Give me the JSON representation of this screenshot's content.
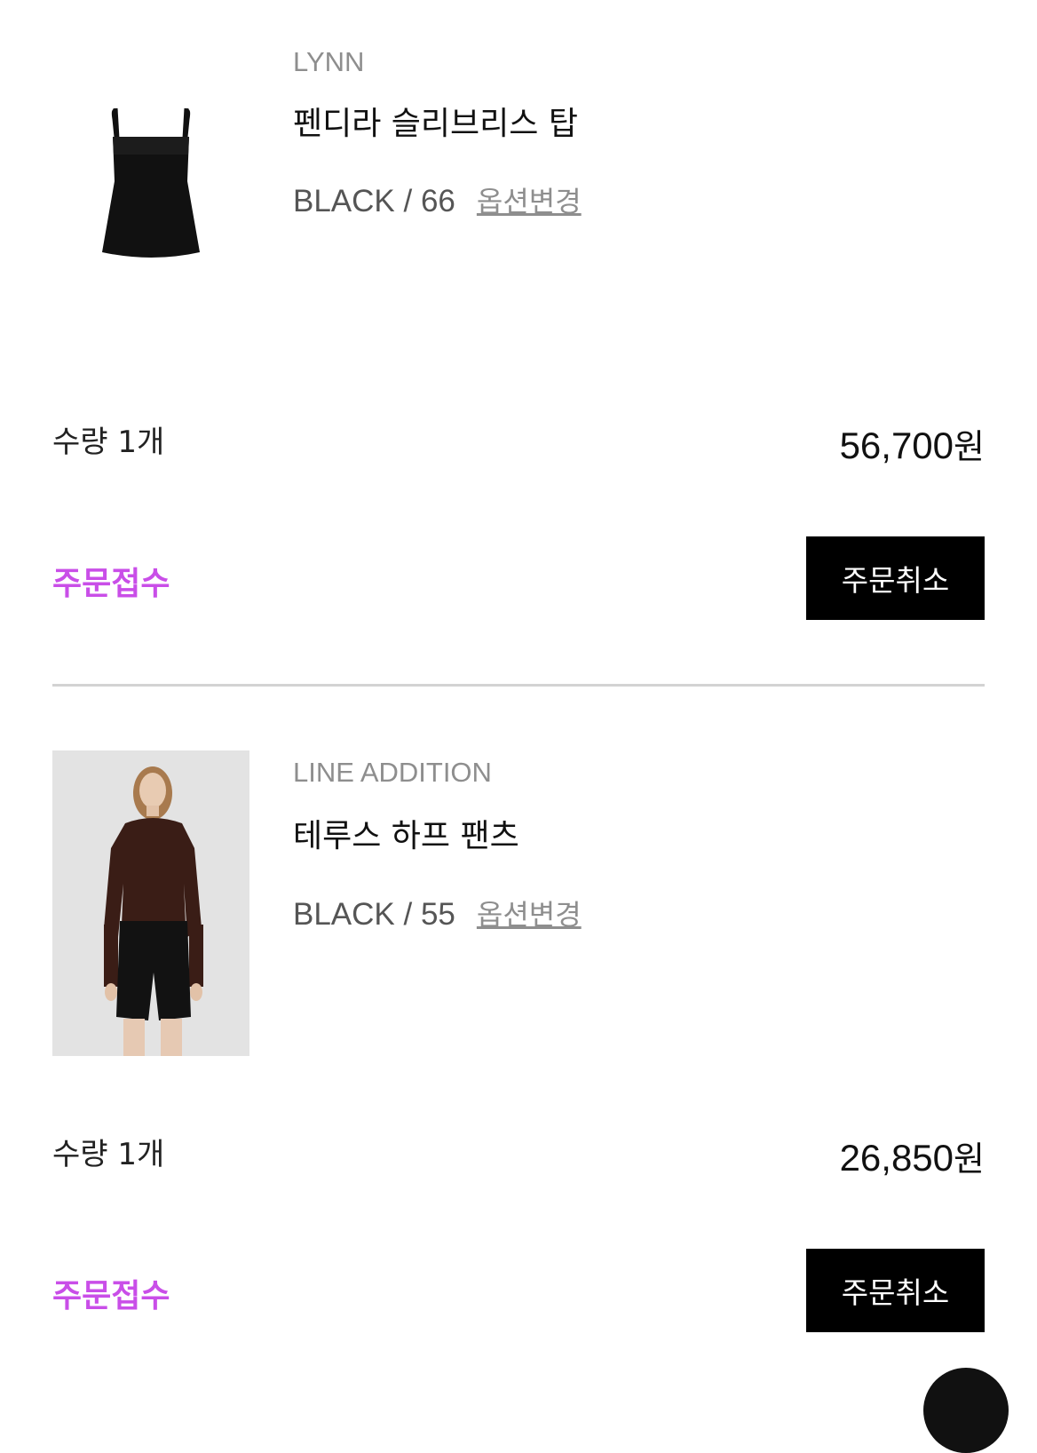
{
  "colors": {
    "status": "#c94ee8",
    "button_bg": "#000000",
    "button_text": "#ffffff",
    "brand_text": "#8e8e8e",
    "divider": "#d3d3d3"
  },
  "items": [
    {
      "brand": "LYNN",
      "name": "펜디라 슬리브리스 탑",
      "option": "BLACK / 66",
      "option_change_label": "옵션변경",
      "quantity": "수량 1개",
      "price": "56,700",
      "currency": "원",
      "status": "주문접수",
      "cancel_label": "주문취소",
      "image": "black-sleeveless-top"
    },
    {
      "brand": "LINE ADDITION",
      "name": "테루스 하프 팬츠",
      "option": "BLACK / 55",
      "option_change_label": "옵션변경",
      "quantity": "수량 1개",
      "price": "26,850",
      "currency": "원",
      "status": "주문접수",
      "cancel_label": "주문취소",
      "image": "model-wearing-half-pants"
    }
  ]
}
